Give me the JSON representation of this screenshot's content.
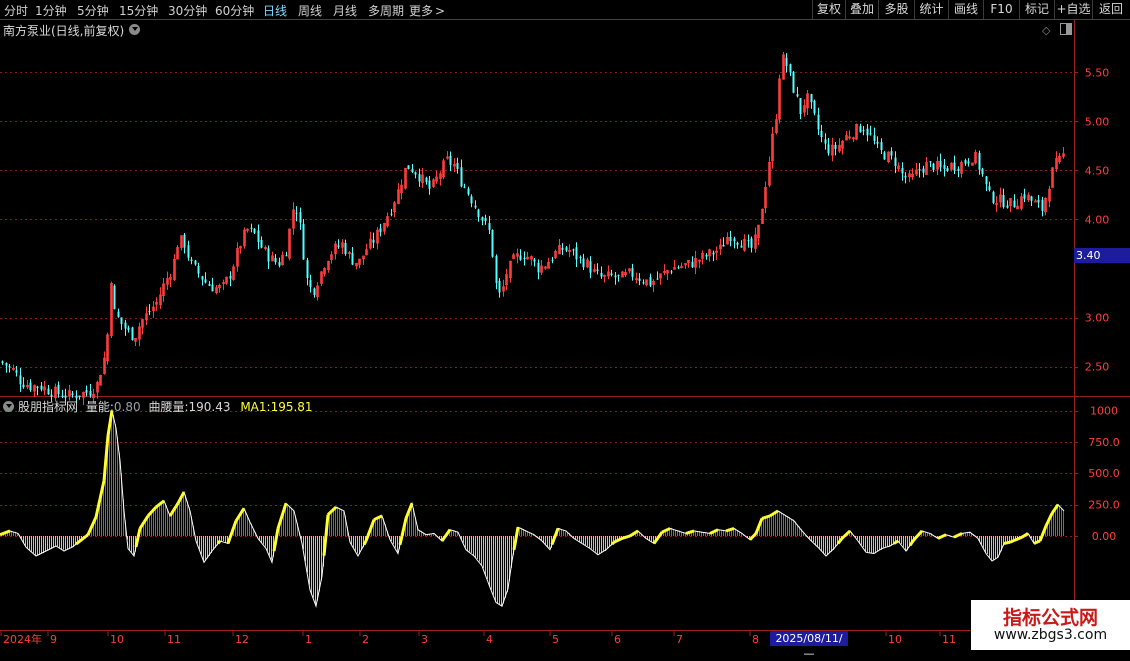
{
  "toolbar": {
    "periods": [
      {
        "label": "分时",
        "active": false
      },
      {
        "label": "1分钟",
        "active": false
      },
      {
        "label": "5分钟",
        "active": false
      },
      {
        "label": "15分钟",
        "active": false
      },
      {
        "label": "30分钟",
        "active": false
      },
      {
        "label": "60分钟",
        "active": false
      },
      {
        "label": "日线",
        "active": true
      },
      {
        "label": "周线",
        "active": false
      },
      {
        "label": "月线",
        "active": false
      },
      {
        "label": "多周期",
        "active": false
      },
      {
        "label": "更多",
        "active": false
      }
    ],
    "more_arrow": ">",
    "buttons": [
      "复权",
      "叠加",
      "多股",
      "统计",
      "画线",
      "F10",
      "标记",
      "+自选",
      "返回"
    ]
  },
  "stock": {
    "title": "南方泵业(日线,前复权)"
  },
  "indicator": {
    "name": "股朋指标网",
    "qn_label": "量能:",
    "qn_value": "0.80",
    "qyl_label": "曲腰量:",
    "qyl_value": "190.43",
    "ma_label": "MA1:",
    "ma_value": "195.81"
  },
  "price_axis": {
    "ticks": [
      "5.50",
      "5.00",
      "4.50",
      "4.00",
      "3.00",
      "2.50"
    ],
    "crosshair_value": "3.40"
  },
  "indicator_axis": {
    "ticks": [
      "1000",
      "750.0",
      "500.0",
      "250.0",
      "0.00"
    ]
  },
  "date_axis": {
    "labels": [
      "2024年",
      "9",
      "10",
      "11",
      "12",
      "1",
      "2",
      "3",
      "4",
      "5",
      "6",
      "7",
      "8",
      "10",
      "11"
    ],
    "crosshair_date": "2025/08/11/—"
  },
  "watermark": {
    "title": "指标公式网",
    "url": "www.zbgs3.com"
  },
  "colors": {
    "up": "#ff3c3c",
    "down": "#54ffff",
    "grid": "#8a1a1a",
    "axis": "#9a2020",
    "curve": "#ffff33",
    "line": "#ffffff",
    "price_text": "#ff3c3c"
  },
  "chart_data": [
    {
      "type": "candlestick",
      "title": "南方泵业(日线,前复权)",
      "ylim": [
        2.2,
        5.85
      ],
      "y_ticks": [
        2.5,
        3.0,
        4.0,
        4.5,
        5.0,
        5.5
      ],
      "x_month_labels": [
        "2024年",
        "9",
        "10",
        "11",
        "12",
        "1",
        "2",
        "3",
        "4",
        "5",
        "6",
        "7",
        "8",
        "10",
        "11"
      ],
      "close_path": [
        [
          0,
          2.55
        ],
        [
          8,
          2.5
        ],
        [
          14,
          2.45
        ],
        [
          20,
          2.35
        ],
        [
          30,
          2.3
        ],
        [
          40,
          2.3
        ],
        [
          50,
          2.25
        ],
        [
          60,
          2.22
        ],
        [
          70,
          2.2
        ],
        [
          80,
          2.22
        ],
        [
          90,
          2.25
        ],
        [
          96,
          2.3
        ],
        [
          100,
          2.45
        ],
        [
          104,
          2.6
        ],
        [
          108,
          2.9
        ],
        [
          110,
          3.45
        ],
        [
          114,
          3.05
        ],
        [
          120,
          2.95
        ],
        [
          128,
          2.85
        ],
        [
          134,
          2.8
        ],
        [
          140,
          2.95
        ],
        [
          148,
          3.05
        ],
        [
          156,
          3.15
        ],
        [
          164,
          3.35
        ],
        [
          172,
          3.5
        ],
        [
          178,
          3.8
        ],
        [
          184,
          3.75
        ],
        [
          190,
          3.55
        ],
        [
          198,
          3.45
        ],
        [
          206,
          3.35
        ],
        [
          214,
          3.3
        ],
        [
          222,
          3.3
        ],
        [
          230,
          3.45
        ],
        [
          238,
          3.7
        ],
        [
          246,
          3.9
        ],
        [
          254,
          3.85
        ],
        [
          262,
          3.7
        ],
        [
          270,
          3.6
        ],
        [
          278,
          3.55
        ],
        [
          286,
          3.7
        ],
        [
          294,
          4.2
        ],
        [
          300,
          3.9
        ],
        [
          306,
          3.4
        ],
        [
          312,
          3.25
        ],
        [
          318,
          3.4
        ],
        [
          326,
          3.6
        ],
        [
          334,
          3.7
        ],
        [
          342,
          3.75
        ],
        [
          350,
          3.6
        ],
        [
          358,
          3.55
        ],
        [
          366,
          3.7
        ],
        [
          374,
          3.8
        ],
        [
          382,
          3.95
        ],
        [
          390,
          4.1
        ],
        [
          398,
          4.3
        ],
        [
          406,
          4.55
        ],
        [
          414,
          4.5
        ],
        [
          422,
          4.4
        ],
        [
          430,
          4.3
        ],
        [
          438,
          4.45
        ],
        [
          446,
          4.6
        ],
        [
          454,
          4.55
        ],
        [
          460,
          4.4
        ],
        [
          466,
          4.3
        ],
        [
          474,
          4.15
        ],
        [
          482,
          4.0
        ],
        [
          490,
          3.85
        ],
        [
          495,
          3.35
        ],
        [
          500,
          3.2
        ],
        [
          506,
          3.45
        ],
        [
          514,
          3.6
        ],
        [
          522,
          3.65
        ],
        [
          530,
          3.6
        ],
        [
          538,
          3.5
        ],
        [
          546,
          3.55
        ],
        [
          554,
          3.65
        ],
        [
          562,
          3.7
        ],
        [
          570,
          3.68
        ],
        [
          578,
          3.6
        ],
        [
          586,
          3.55
        ],
        [
          594,
          3.45
        ],
        [
          602,
          3.4
        ],
        [
          610,
          3.42
        ],
        [
          620,
          3.4
        ],
        [
          630,
          3.45
        ],
        [
          640,
          3.4
        ],
        [
          650,
          3.35
        ],
        [
          660,
          3.42
        ],
        [
          670,
          3.5
        ],
        [
          680,
          3.52
        ],
        [
          690,
          3.55
        ],
        [
          700,
          3.6
        ],
        [
          710,
          3.65
        ],
        [
          720,
          3.7
        ],
        [
          728,
          3.85
        ],
        [
          736,
          3.8
        ],
        [
          744,
          3.75
        ],
        [
          752,
          3.7
        ],
        [
          758,
          3.9
        ],
        [
          764,
          4.3
        ],
        [
          770,
          4.7
        ],
        [
          776,
          5.1
        ],
        [
          780,
          5.6
        ],
        [
          784,
          5.65
        ],
        [
          788,
          5.5
        ],
        [
          794,
          5.3
        ],
        [
          800,
          5.1
        ],
        [
          806,
          5.25
        ],
        [
          812,
          5.1
        ],
        [
          818,
          4.9
        ],
        [
          824,
          4.75
        ],
        [
          830,
          4.7
        ],
        [
          838,
          4.75
        ],
        [
          846,
          4.85
        ],
        [
          854,
          4.9
        ],
        [
          862,
          4.95
        ],
        [
          870,
          4.85
        ],
        [
          878,
          4.7
        ],
        [
          886,
          4.65
        ],
        [
          894,
          4.6
        ],
        [
          902,
          4.45
        ],
        [
          910,
          4.4
        ],
        [
          918,
          4.5
        ],
        [
          926,
          4.55
        ],
        [
          934,
          4.55
        ],
        [
          942,
          4.5
        ],
        [
          950,
          4.55
        ],
        [
          958,
          4.55
        ],
        [
          966,
          4.6
        ],
        [
          974,
          4.65
        ],
        [
          982,
          4.45
        ],
        [
          988,
          4.25
        ],
        [
          996,
          4.2
        ],
        [
          1004,
          4.18
        ],
        [
          1012,
          4.15
        ],
        [
          1018,
          4.2
        ],
        [
          1024,
          4.25
        ],
        [
          1030,
          4.2
        ],
        [
          1036,
          4.15
        ],
        [
          1042,
          4.1
        ],
        [
          1048,
          4.35
        ],
        [
          1054,
          4.55
        ],
        [
          1060,
          4.6
        ],
        [
          1065,
          4.7
        ]
      ]
    },
    {
      "type": "bar",
      "title": "股朋指标网",
      "ylim": [
        -750,
        1100
      ],
      "y_ticks": [
        0,
        250,
        500,
        750,
        1000
      ],
      "series_legend": [
        {
          "name": "曲腰量",
          "value": 190.43
        },
        {
          "name": "MA1",
          "value": 195.81
        }
      ],
      "value_path": [
        [
          0,
          10
        ],
        [
          10,
          40
        ],
        [
          18,
          20
        ],
        [
          26,
          -90
        ],
        [
          36,
          -160
        ],
        [
          46,
          -120
        ],
        [
          56,
          -80
        ],
        [
          64,
          -120
        ],
        [
          72,
          -90
        ],
        [
          80,
          -40
        ],
        [
          88,
          10
        ],
        [
          96,
          150
        ],
        [
          104,
          440
        ],
        [
          108,
          800
        ],
        [
          112,
          1000
        ],
        [
          116,
          860
        ],
        [
          120,
          600
        ],
        [
          124,
          200
        ],
        [
          128,
          -100
        ],
        [
          134,
          -160
        ],
        [
          140,
          60
        ],
        [
          148,
          160
        ],
        [
          156,
          230
        ],
        [
          164,
          280
        ],
        [
          170,
          160
        ],
        [
          178,
          260
        ],
        [
          184,
          350
        ],
        [
          190,
          200
        ],
        [
          196,
          -40
        ],
        [
          204,
          -210
        ],
        [
          212,
          -120
        ],
        [
          220,
          -40
        ],
        [
          228,
          -60
        ],
        [
          236,
          120
        ],
        [
          244,
          220
        ],
        [
          250,
          110
        ],
        [
          258,
          -20
        ],
        [
          266,
          -100
        ],
        [
          272,
          -210
        ],
        [
          278,
          60
        ],
        [
          286,
          260
        ],
        [
          294,
          200
        ],
        [
          302,
          -60
        ],
        [
          310,
          -430
        ],
        [
          316,
          -560
        ],
        [
          322,
          -320
        ],
        [
          328,
          170
        ],
        [
          336,
          230
        ],
        [
          344,
          200
        ],
        [
          350,
          -50
        ],
        [
          358,
          -160
        ],
        [
          366,
          -40
        ],
        [
          374,
          130
        ],
        [
          382,
          160
        ],
        [
          390,
          -30
        ],
        [
          398,
          -140
        ],
        [
          406,
          140
        ],
        [
          412,
          260
        ],
        [
          418,
          50
        ],
        [
          426,
          10
        ],
        [
          434,
          20
        ],
        [
          442,
          -40
        ],
        [
          450,
          50
        ],
        [
          458,
          30
        ],
        [
          466,
          -110
        ],
        [
          474,
          -160
        ],
        [
          482,
          -240
        ],
        [
          490,
          -410
        ],
        [
          496,
          -530
        ],
        [
          502,
          -560
        ],
        [
          508,
          -420
        ],
        [
          512,
          -200
        ],
        [
          518,
          70
        ],
        [
          526,
          40
        ],
        [
          534,
          10
        ],
        [
          542,
          -40
        ],
        [
          550,
          -110
        ],
        [
          558,
          60
        ],
        [
          566,
          40
        ],
        [
          574,
          -20
        ],
        [
          582,
          -60
        ],
        [
          590,
          -100
        ],
        [
          598,
          -150
        ],
        [
          606,
          -110
        ],
        [
          614,
          -50
        ],
        [
          622,
          -20
        ],
        [
          630,
          0
        ],
        [
          638,
          40
        ],
        [
          646,
          -20
        ],
        [
          654,
          -60
        ],
        [
          662,
          30
        ],
        [
          670,
          60
        ],
        [
          678,
          40
        ],
        [
          686,
          20
        ],
        [
          694,
          40
        ],
        [
          702,
          30
        ],
        [
          710,
          20
        ],
        [
          718,
          50
        ],
        [
          726,
          40
        ],
        [
          734,
          60
        ],
        [
          742,
          20
        ],
        [
          750,
          -30
        ],
        [
          756,
          20
        ],
        [
          762,
          140
        ],
        [
          770,
          160
        ],
        [
          778,
          200
        ],
        [
          786,
          160
        ],
        [
          794,
          120
        ],
        [
          802,
          40
        ],
        [
          810,
          -30
        ],
        [
          818,
          -90
        ],
        [
          826,
          -160
        ],
        [
          834,
          -100
        ],
        [
          842,
          -20
        ],
        [
          850,
          40
        ],
        [
          858,
          -40
        ],
        [
          866,
          -130
        ],
        [
          874,
          -140
        ],
        [
          882,
          -100
        ],
        [
          890,
          -80
        ],
        [
          898,
          -40
        ],
        [
          906,
          -120
        ],
        [
          914,
          -30
        ],
        [
          922,
          40
        ],
        [
          930,
          20
        ],
        [
          938,
          -20
        ],
        [
          946,
          10
        ],
        [
          954,
          -10
        ],
        [
          962,
          20
        ],
        [
          970,
          30
        ],
        [
          978,
          -20
        ],
        [
          986,
          -140
        ],
        [
          992,
          -200
        ],
        [
          998,
          -170
        ],
        [
          1004,
          -60
        ],
        [
          1010,
          -50
        ],
        [
          1016,
          -30
        ],
        [
          1022,
          -10
        ],
        [
          1028,
          20
        ],
        [
          1034,
          -60
        ],
        [
          1040,
          -40
        ],
        [
          1046,
          80
        ],
        [
          1052,
          180
        ],
        [
          1058,
          250
        ],
        [
          1064,
          200
        ]
      ]
    }
  ]
}
